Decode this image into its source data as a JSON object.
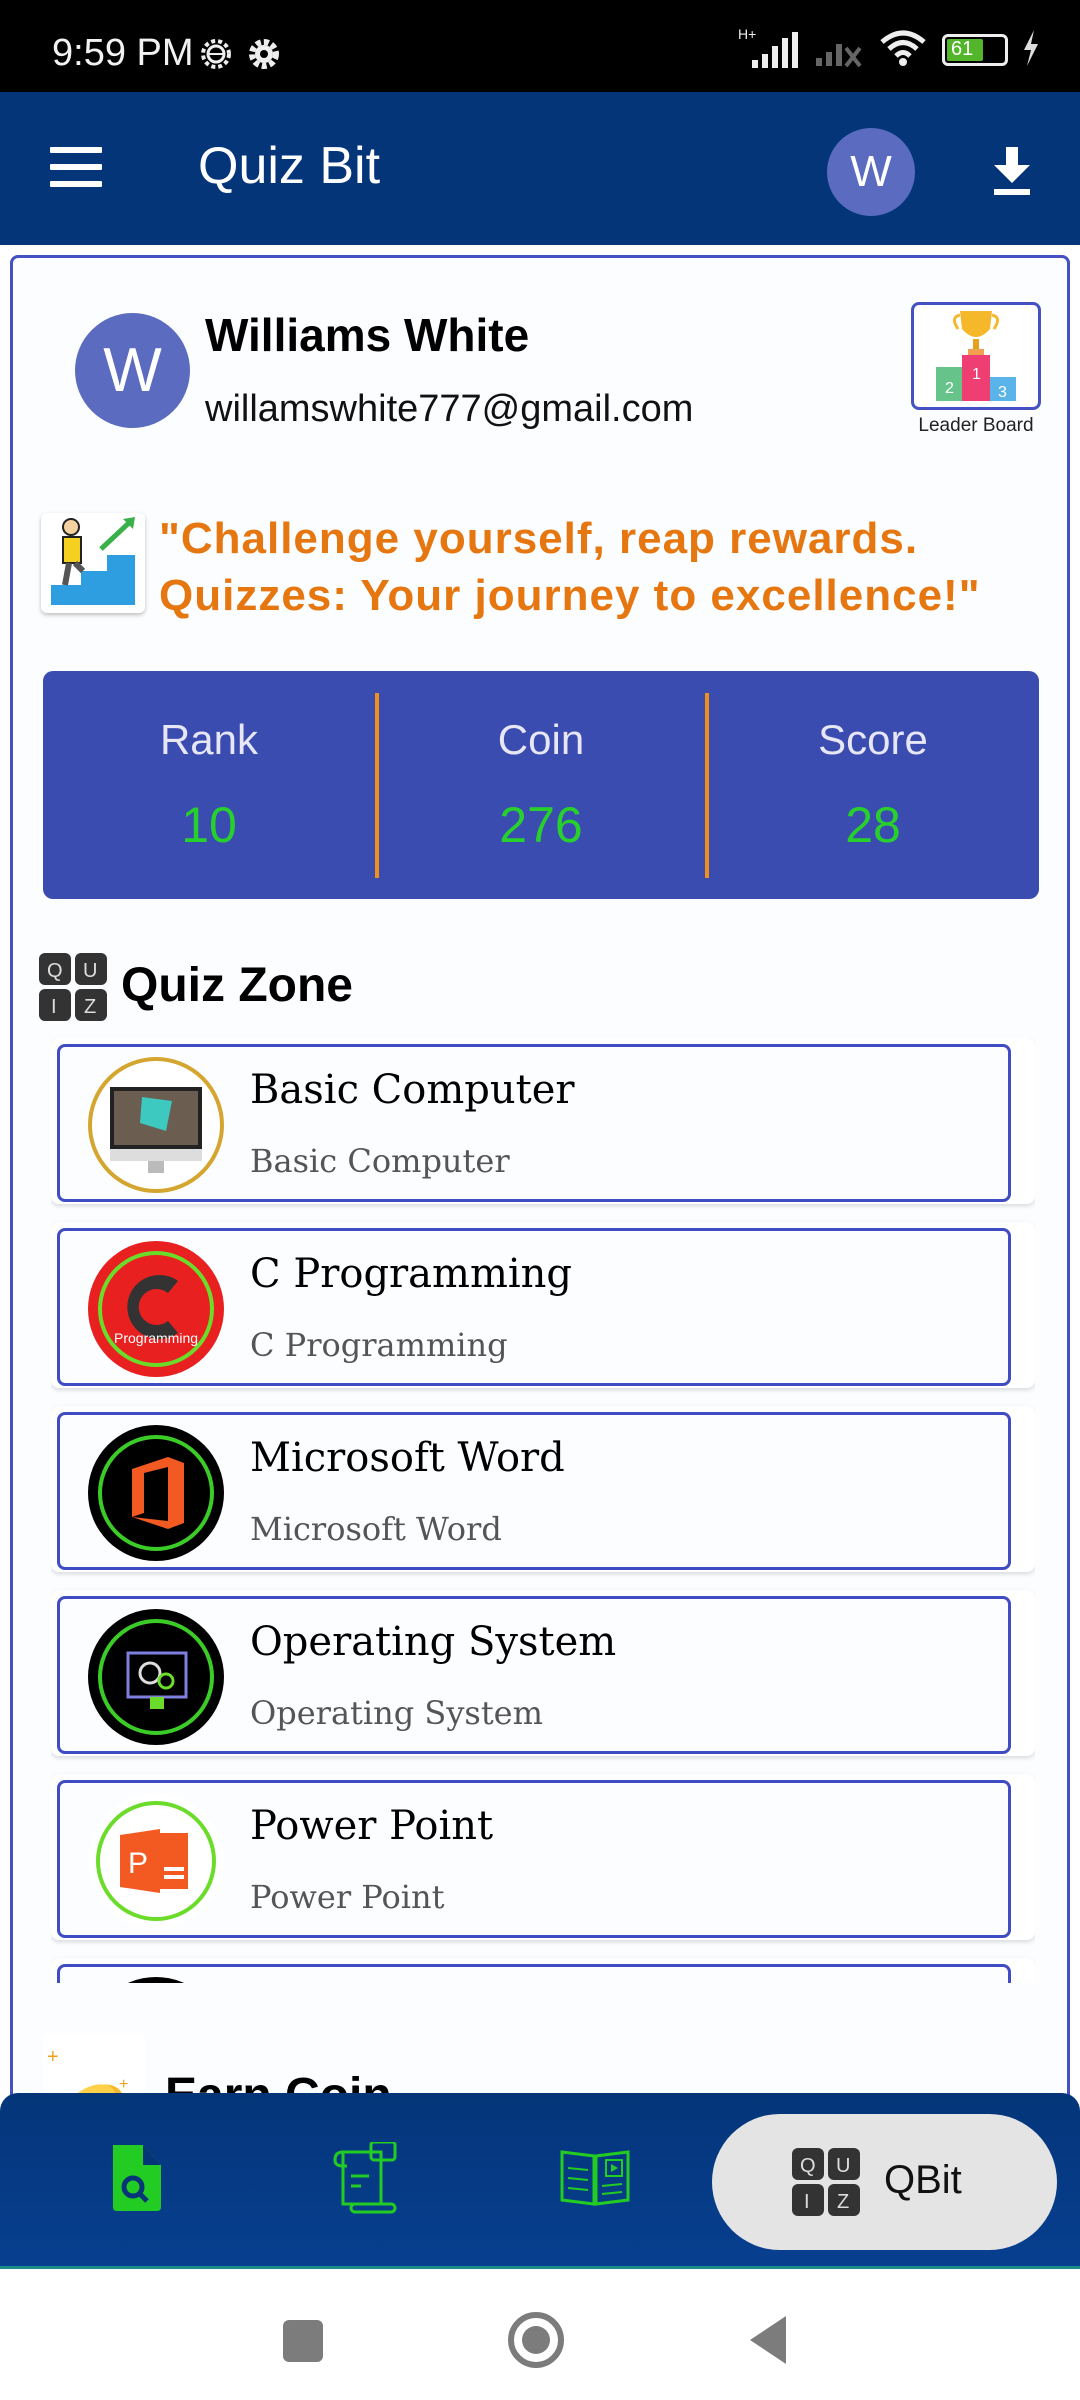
{
  "status_bar": {
    "time": "9:59 PM",
    "network": "H+",
    "battery": "61"
  },
  "app_bar": {
    "title": "Quiz Bit",
    "avatar_initial": "W",
    "menu_icon": "hamburger-menu-icon",
    "download_icon": "download-icon"
  },
  "profile": {
    "avatar_initial": "W",
    "name": "Williams White",
    "email": "willamswhite777@gmail.com",
    "leaderboard_label": "Leader Board"
  },
  "quote": {
    "line1": "\"Challenge yourself, reap rewards.",
    "line2": "Quizzes: Your journey to excellence!\""
  },
  "stats": [
    {
      "label": "Rank",
      "value": "10"
    },
    {
      "label": "Coin",
      "value": "276"
    },
    {
      "label": "Score",
      "value": "28"
    }
  ],
  "quiz_zone": {
    "title": "Quiz Zone",
    "items": [
      {
        "title": "Basic Computer",
        "subtitle": "Basic Computer"
      },
      {
        "title": "C Programming",
        "subtitle": "C Programming"
      },
      {
        "title": "Microsoft Word",
        "subtitle": "Microsoft Word"
      },
      {
        "title": "Operating System",
        "subtitle": "Operating System"
      },
      {
        "title": "Power Point",
        "subtitle": "Power Point"
      }
    ]
  },
  "earn_coin": {
    "title": "Earn Coin"
  },
  "bottom_nav": {
    "items": [
      {
        "icon": "document-search-icon"
      },
      {
        "icon": "scroll-chat-icon"
      },
      {
        "icon": "book-video-icon"
      },
      {
        "icon": "quiz-icon",
        "label": "QBit",
        "active": true
      }
    ]
  },
  "colors": {
    "app_bar": "#043579",
    "accent": "#3f4cc4",
    "stats_bg": "#3a4cb0",
    "stat_value": "#28d02e",
    "divider": "#f0901c",
    "quote": "#e6760f",
    "nav_icon": "#22cc22"
  }
}
